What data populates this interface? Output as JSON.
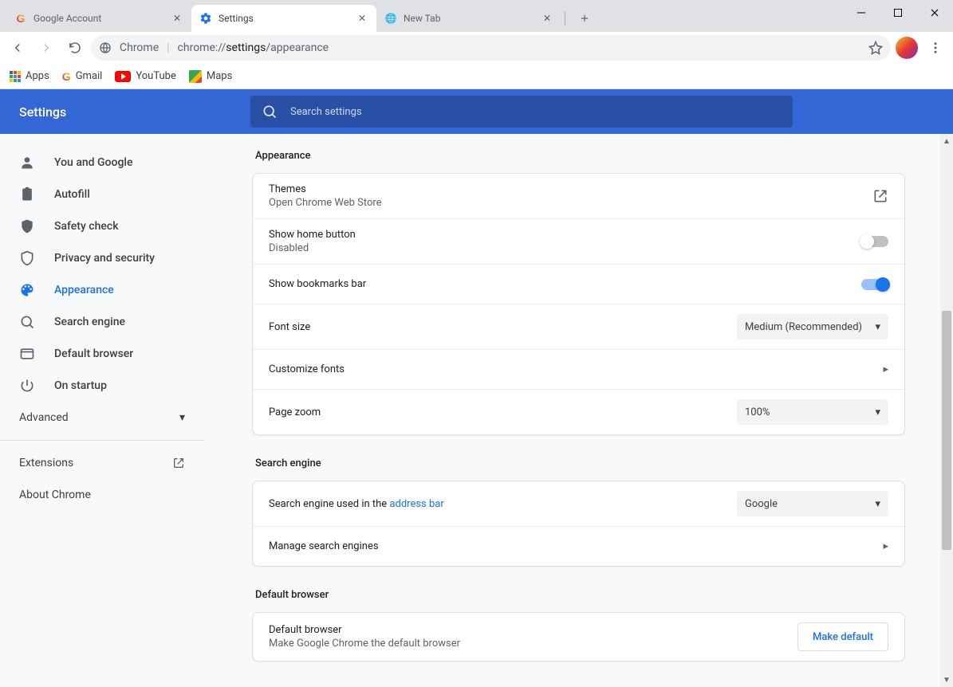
{
  "window": {
    "controls": {
      "minimize": "—",
      "maximize": "☐",
      "close": "✕"
    }
  },
  "tabs": [
    {
      "title": "Google Account",
      "active": false
    },
    {
      "title": "Settings",
      "active": true
    },
    {
      "title": "New Tab",
      "active": false
    }
  ],
  "omnibox": {
    "chip": "Chrome",
    "url_scheme": "chrome://",
    "url_path_bold": "settings",
    "url_path_tail": "/appearance"
  },
  "bookmarks": [
    {
      "label": "Apps"
    },
    {
      "label": "Gmail"
    },
    {
      "label": "YouTube"
    },
    {
      "label": "Maps"
    }
  ],
  "header": {
    "title": "Settings",
    "search_placeholder": "Search settings"
  },
  "sidebar": {
    "items": [
      {
        "label": "You and Google"
      },
      {
        "label": "Autofill"
      },
      {
        "label": "Safety check"
      },
      {
        "label": "Privacy and security"
      },
      {
        "label": "Appearance"
      },
      {
        "label": "Search engine"
      },
      {
        "label": "Default browser"
      },
      {
        "label": "On startup"
      }
    ],
    "advanced": "Advanced",
    "extensions": "Extensions",
    "about": "About Chrome"
  },
  "sections": {
    "appearance": {
      "title": "Appearance",
      "themes": {
        "label": "Themes",
        "sub": "Open Chrome Web Store"
      },
      "home": {
        "label": "Show home button",
        "sub": "Disabled",
        "on": false
      },
      "bookmarks": {
        "label": "Show bookmarks bar",
        "on": true
      },
      "fontsize": {
        "label": "Font size",
        "value": "Medium (Recommended)"
      },
      "customfonts": {
        "label": "Customize fonts"
      },
      "zoom": {
        "label": "Page zoom",
        "value": "100%"
      }
    },
    "search": {
      "title": "Search engine",
      "used_prefix": "Search engine used in the ",
      "used_link": "address bar",
      "value": "Google",
      "manage": "Manage search engines"
    },
    "default_browser": {
      "title": "Default browser",
      "label": "Default browser",
      "sub": "Make Google Chrome the default browser",
      "button": "Make default"
    }
  }
}
